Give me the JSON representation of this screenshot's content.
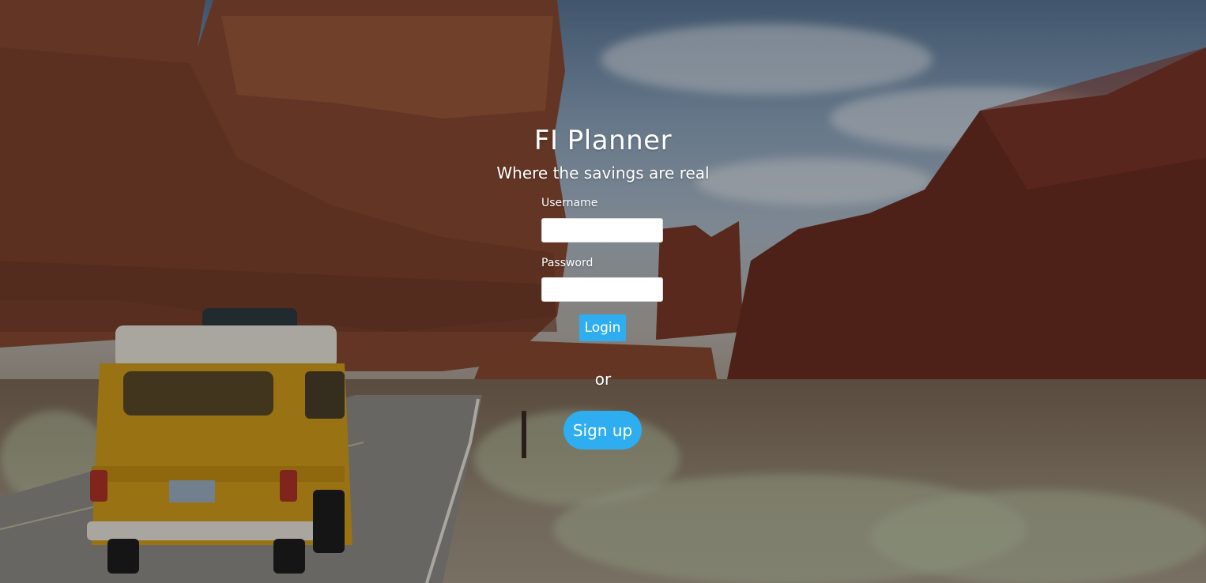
{
  "app": {
    "title": "FI Planner",
    "tagline": "Where the savings are real"
  },
  "login_form": {
    "username_label": "Username",
    "username_value": "",
    "password_label": "Password",
    "password_value": "",
    "login_label": "Login"
  },
  "divider_text": "or",
  "signup_label": "Sign up",
  "colors": {
    "accent": "#2eaef0",
    "text": "#ffffff"
  },
  "background": {
    "description_icon": "desert-road-van-photo"
  }
}
